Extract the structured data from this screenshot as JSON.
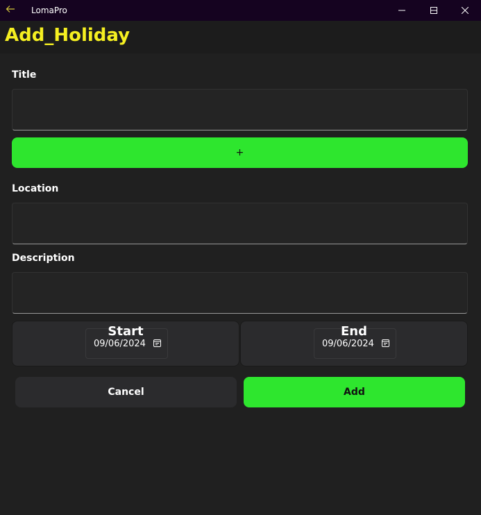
{
  "window": {
    "app_title": "LomaPro",
    "back_icon": "arrow-left-icon",
    "minimize_icon": "minimize-icon",
    "maximize_icon": "maximize-icon",
    "close_icon": "close-icon"
  },
  "page": {
    "title": "Add_Holiday"
  },
  "form": {
    "title_label": "Title",
    "title_value": "",
    "add_image_label": "+",
    "location_label": "Location",
    "location_value": "",
    "description_label": "Description",
    "description_value": ""
  },
  "dates": {
    "start_label": "Start",
    "start_value": "09/06/2024",
    "end_label": "End",
    "end_value": "09/06/2024",
    "calendar_icon": "calendar-icon"
  },
  "actions": {
    "cancel_label": "Cancel",
    "add_label": "Add"
  },
  "colors": {
    "accent_green": "#2ee62e",
    "title_yellow": "#f5ef21",
    "titlebar_bg": "#150320",
    "page_bg": "#202020"
  }
}
